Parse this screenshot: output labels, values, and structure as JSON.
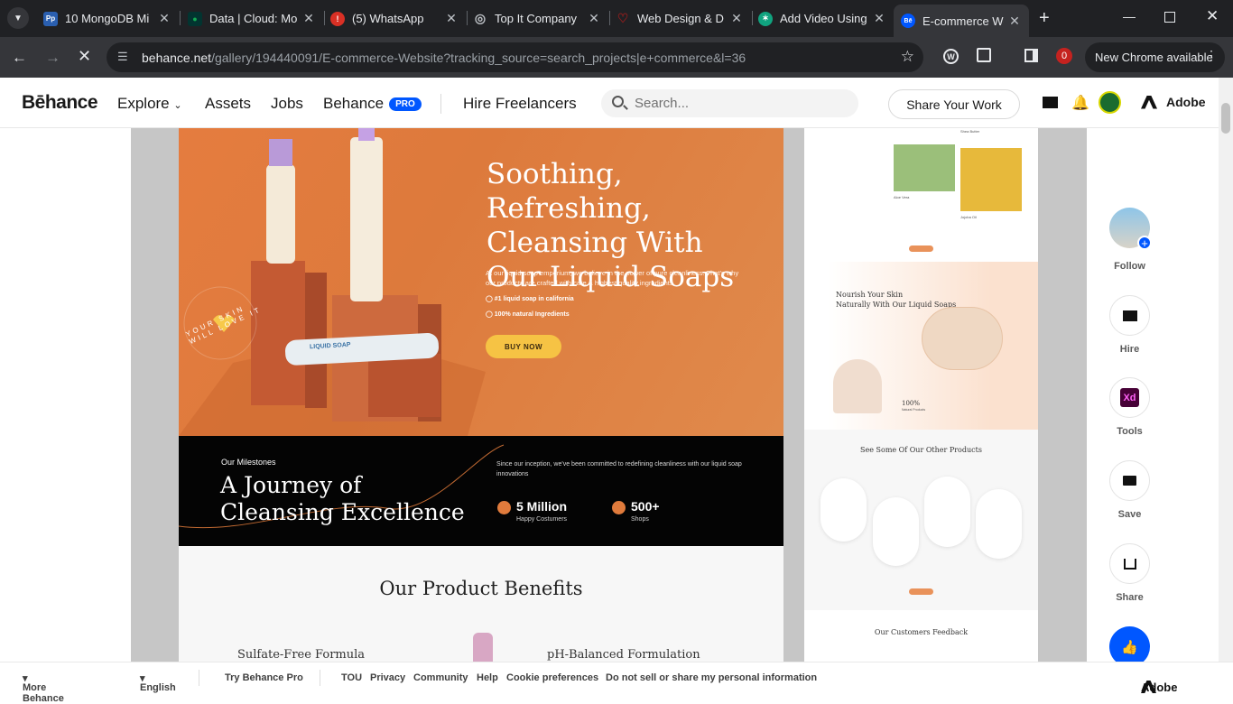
{
  "browser": {
    "tabs": [
      {
        "title": "10 MongoDB Mi",
        "favicon": "Pp"
      },
      {
        "title": "Data | Cloud: Mo",
        "favicon": "leaf"
      },
      {
        "title": "(5) WhatsApp",
        "favicon": "!"
      },
      {
        "title": "Top It Company",
        "favicon": "globe"
      },
      {
        "title": "Web Design & D",
        "favicon": "heart"
      },
      {
        "title": "Add Video Using",
        "favicon": "openai"
      },
      {
        "title": "E-commerce We",
        "favicon": "Bē"
      }
    ],
    "url_host": "behance.net",
    "url_path": "/gallery/194440091/E-commerce-Website?tracking_source=search_projects|e+commerce&l=36",
    "extension_badge": "0",
    "update_label": "New Chrome available"
  },
  "behance": {
    "logo": "Bēhance",
    "nav": [
      "Explore",
      "Assets",
      "Jobs",
      "Behance"
    ],
    "pro_badge": "PRO",
    "hire": "Hire Freelancers",
    "search_placeholder": "Search...",
    "share_work": "Share Your Work",
    "adobe": "Adobe"
  },
  "hero": {
    "title": "Soothing, Refreshing, Cleansing With Our Liquid Soaps",
    "subtitle": "At our liquid soap emporium, we believe in the power of pure cleanliness. That's why our products are crafted with care & highest quality ingredients.",
    "check1": "#1 liquid soap in california",
    "check2": "100% natural Ingredients",
    "buy": "BUY NOW",
    "stamp": "YOUR SKIN WILL LOVE IT",
    "bottle_label": "LIQUID SOAP"
  },
  "milestones": {
    "eyebrow": "Our Milestones",
    "title_line1": "A Journey of",
    "title_line2": "Cleansing Excellence",
    "desc": "Since our inception, we've been committed to redefining cleanliness with our liquid soap innovations",
    "stat1_value": "5 Million",
    "stat1_label": "Happy Costumers",
    "stat2_value": "500+",
    "stat2_label": "Shops"
  },
  "benefits": {
    "heading": "Our Product Benefits",
    "item1": "Sulfate-Free Formula",
    "item2": "pH-Balanced Formulation"
  },
  "preview": {
    "aloe": "Aloe Vera",
    "oil": "Jojoba Oil",
    "shea": "Shea Butter",
    "nourish_line1": "Nourish Your Skin",
    "nourish_line2": "Naturally With Our Liquid Soaps",
    "natural_value": "100%",
    "natural_label": "Natural Products",
    "others_heading": "See Some Of Our Other Products",
    "feedback_heading": "Our Customers Feedback"
  },
  "sidebar": {
    "follow": "Follow",
    "hire": "Hire",
    "tools": "Tools",
    "xd": "Xd",
    "save": "Save",
    "share": "Share"
  },
  "footer": {
    "more": "More Behance",
    "language": "English",
    "try_pro": "Try Behance Pro",
    "links": [
      "TOU",
      "Privacy",
      "Community",
      "Help",
      "Cookie preferences",
      "Do not sell or share my personal information"
    ],
    "adobe": "Adobe"
  },
  "colors": {
    "accent_orange": "#e57c3f",
    "behance_blue": "#0057ff",
    "button_yellow": "#f6c344"
  }
}
